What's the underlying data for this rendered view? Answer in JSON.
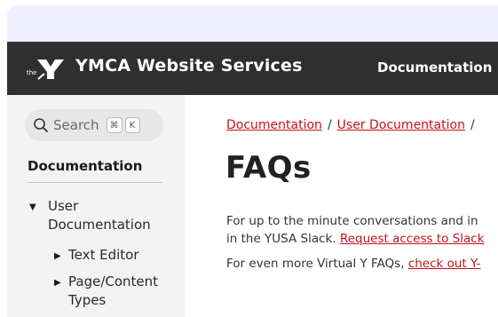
{
  "header": {
    "brand": "YMCA Website Services",
    "nav_documentation": "Documentation",
    "logo_the": "the"
  },
  "sidebar": {
    "search_label": "Search",
    "search_keys": [
      "⌘",
      "K"
    ],
    "heading": "Documentation",
    "tree": {
      "user_doc_line1": "User",
      "user_doc_line2": "Documentation",
      "text_editor": "Text Editor",
      "page_content_line1": "Page/Content",
      "page_content_line2": "Types"
    }
  },
  "main": {
    "breadcrumb": {
      "item1": "Documentation",
      "sep1": "/",
      "item2": "User Documentation",
      "sep2": "/"
    },
    "title": "FAQs",
    "para1_line1": "For up to the minute conversations and in",
    "para1_line2_prefix": "in the YUSA Slack.",
    "para1_link": "Request access to Slack",
    "para2_prefix": "For even more Virtual Y FAQs,",
    "para2_link": "check out Y-"
  },
  "colors": {
    "header_bg": "#2f2f2f",
    "link": "#c4121b",
    "top_band": "#efeefe",
    "sidebar_bg": "#f3f3f3"
  },
  "icons": [
    "ymca-logo-icon",
    "search-icon",
    "caret-down-icon",
    "caret-right-icon"
  ]
}
